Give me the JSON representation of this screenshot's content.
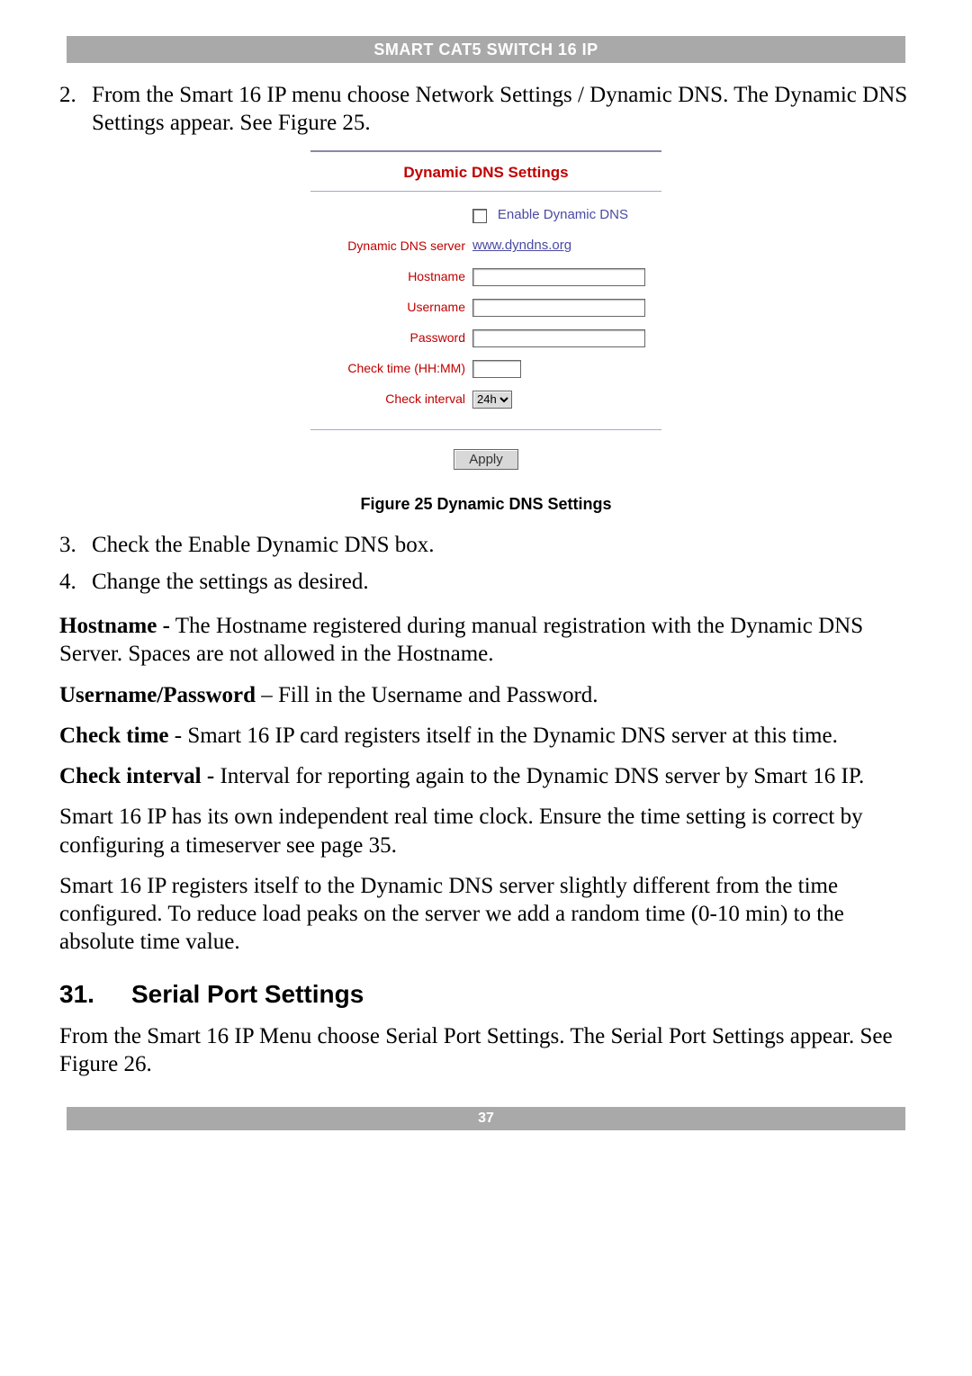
{
  "header": {
    "title": "SMART CAT5 SWITCH 16 IP"
  },
  "step2": {
    "num": "2.",
    "text": "From the Smart 16 IP menu choose Network Settings / Dynamic DNS. The Dynamic DNS Settings appear. See Figure 25."
  },
  "panel": {
    "title": "Dynamic DNS Settings",
    "enable_label": "Enable Dynamic DNS",
    "rows": {
      "server_label": "Dynamic DNS server",
      "server_value": "www.dyndns.org",
      "hostname_label": "Hostname",
      "username_label": "Username",
      "password_label": "Password",
      "checktime_label": "Check time (HH:MM)",
      "checkinterval_label": "Check interval",
      "checkinterval_value": "24h"
    },
    "apply_label": "Apply"
  },
  "fig_caption": "Figure 25 Dynamic DNS Settings",
  "step3": {
    "num": "3.",
    "text": "Check the Enable Dynamic DNS box."
  },
  "step4": {
    "num": "4.",
    "text": "Change the settings as desired."
  },
  "para_hostname": {
    "bold": "Hostname -",
    "text": " The Hostname registered during manual registration with the Dynamic DNS Server. Spaces are not allowed in the Hostname."
  },
  "para_userpass": {
    "bold": "Username/Password",
    "text": " – Fill in the Username and Password."
  },
  "para_checktime": {
    "bold": "Check time",
    "text": " - Smart 16 IP card registers itself in the Dynamic DNS server at this time."
  },
  "para_checkinterval": {
    "bold": "Check interval -",
    "text": " Interval for reporting again to the Dynamic DNS server by Smart 16 IP."
  },
  "para_rtc": "Smart 16 IP has its own independent real time clock. Ensure the time setting is correct by configuring a timeserver see page 35.",
  "para_register": "Smart 16 IP registers itself to the Dynamic DNS server slightly different from the time configured. To reduce load peaks on the server we add a random time (0-10 min) to the absolute time value.",
  "section": {
    "num": "31.",
    "title": "Serial Port Settings",
    "text": "From the Smart 16 IP Menu choose Serial Port Settings. The Serial Port Settings appear. See Figure 26."
  },
  "footer": {
    "page": "37"
  }
}
